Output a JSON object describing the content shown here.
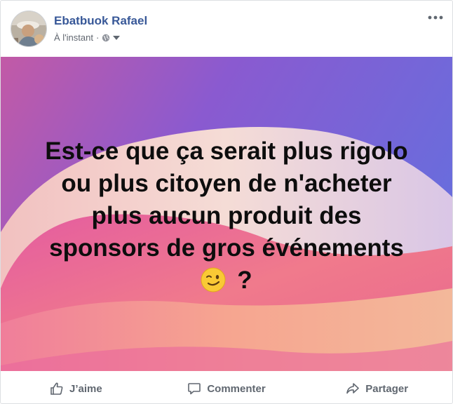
{
  "post": {
    "author": "Ebatbuok Rafael",
    "timestamp": "À l'instant",
    "separator": "·",
    "privacy_icon": "globe-icon",
    "menu_icon": "more-options-icon",
    "text_lines": [
      "Est-ce que ça serait plus rigolo",
      "ou plus citoyen de n'acheter",
      "plus aucun produit des",
      "sponsors de gros événements"
    ],
    "text_end": "?",
    "emoji": "winking-face-icon",
    "background_colors": {
      "purple": "#7a5cd6",
      "pink": "#e85a9a",
      "peach": "#f6b79c",
      "cream": "#f4ddd7"
    }
  },
  "actions": [
    {
      "label": "J’aime",
      "icon": "thumbs-up-icon"
    },
    {
      "label": "Commenter",
      "icon": "comment-icon"
    },
    {
      "label": "Partager",
      "icon": "share-icon"
    }
  ],
  "colors": {
    "author": "#385898",
    "meta": "#616770",
    "action": "#606770"
  }
}
